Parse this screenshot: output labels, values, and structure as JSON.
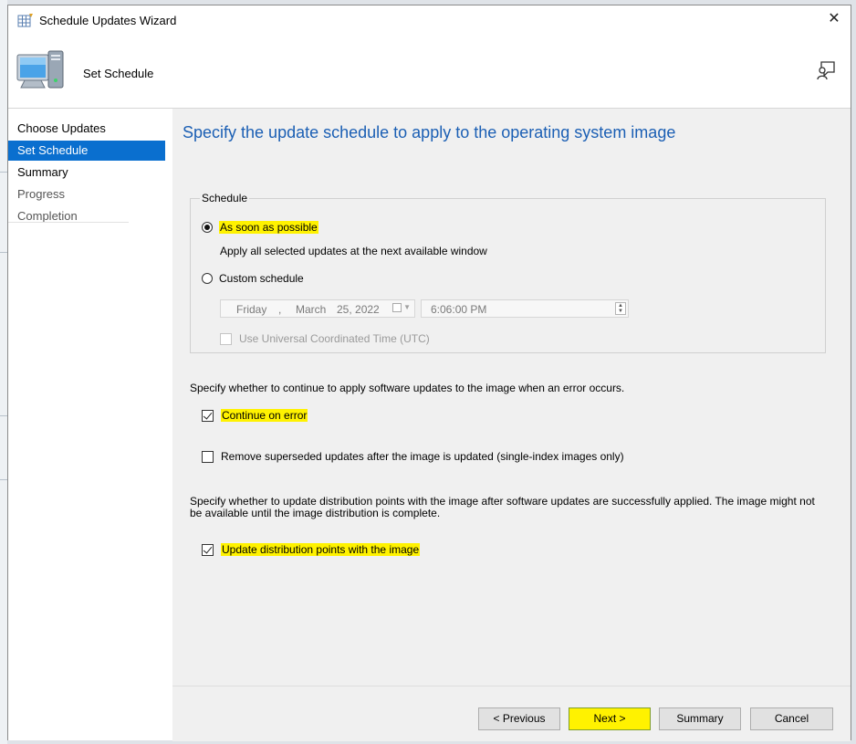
{
  "window": {
    "title": "Schedule Updates Wizard",
    "close_glyph": "✕",
    "page_title": "Set Schedule"
  },
  "nav": {
    "items": [
      {
        "label": "Choose Updates",
        "state": "normal"
      },
      {
        "label": "Set Schedule",
        "state": "active"
      },
      {
        "label": "Summary",
        "state": "normal"
      },
      {
        "label": "Progress",
        "state": "disabled"
      },
      {
        "label": "Completion",
        "state": "disabled"
      }
    ]
  },
  "content": {
    "heading": "Specify the update schedule to apply to the operating system image",
    "schedule": {
      "legend": "Schedule",
      "asap_label": "As soon as possible",
      "asap_desc": "Apply all selected updates at the next available window",
      "custom_label": "Custom schedule",
      "date": {
        "day": "Friday",
        "sep": ",",
        "month": "March",
        "date": "25, 2022"
      },
      "time": "6:06:00 PM",
      "utc_label": "Use Universal Coordinated Time (UTC)"
    },
    "error_prompt": "Specify whether to continue to apply software updates to the image when an error occurs.",
    "continue_label": "Continue on error",
    "remove_label": "Remove superseded updates after the image is updated (single-index images only)",
    "dp_prompt": "Specify whether to update distribution points with the image after software updates are successfully applied. The image might not be available until the image distribution is complete.",
    "dp_label": "Update distribution points with the image"
  },
  "footer": {
    "previous": "< Previous",
    "next": "Next >",
    "summary": "Summary",
    "cancel": "Cancel"
  },
  "colors": {
    "accent": "#0a6fcf",
    "heading": "#1b5fb4",
    "highlight": "#fff200"
  }
}
